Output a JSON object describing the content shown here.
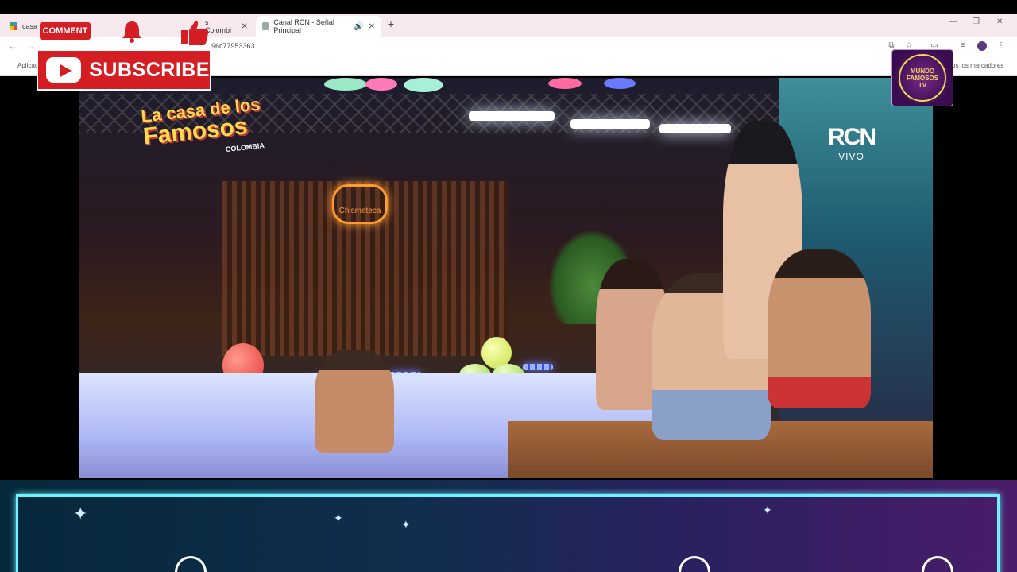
{
  "browser": {
    "tabs": [
      {
        "label": "casa",
        "active": false
      },
      {
        "label": "s Colombi",
        "active": false
      },
      {
        "label": "Canal RCN - Señal Principal",
        "active": true
      }
    ],
    "url_fragment": "96c77953363",
    "bookmarks_left": "Aplicac",
    "bookmarks_right": "os los marcadores"
  },
  "overlay": {
    "comment_label": "COMMENT",
    "subscribe_label": "SUBSCRIBE",
    "channel_logo_text": "MUNDO FAMOSOS TV"
  },
  "video": {
    "show_logo_line1": "La casa de los",
    "show_logo_line2": "Famosos",
    "show_logo_sub": "COLOMBIA",
    "network_mark": "RCN",
    "live_label": "VIVO",
    "sign_text": "Chismeteca"
  },
  "colors": {
    "youtube_red": "#d51e24",
    "banner_glow": "#6ff3ff"
  }
}
